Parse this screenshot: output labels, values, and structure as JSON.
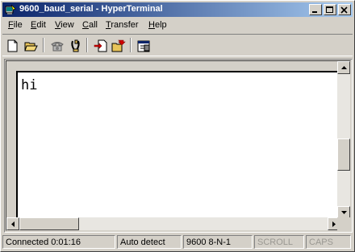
{
  "window": {
    "title": "9600_baud_serial - HyperTerminal",
    "title_bar_colors": {
      "start": "#0a246a",
      "end": "#a6caf0"
    }
  },
  "title_buttons": {
    "minimize": "minimize-icon",
    "maximize": "maximize-icon",
    "close": "close-icon"
  },
  "menu": {
    "items": [
      {
        "label": "File",
        "underline": "F"
      },
      {
        "label": "Edit",
        "underline": "E"
      },
      {
        "label": "View",
        "underline": "V"
      },
      {
        "label": "Call",
        "underline": "C"
      },
      {
        "label": "Transfer",
        "underline": "T"
      },
      {
        "label": "Help",
        "underline": "H"
      }
    ]
  },
  "toolbar": {
    "buttons": [
      "new-document-icon",
      "open-folder-icon",
      "connect-phone-icon",
      "disconnect-phone-icon",
      "send-file-icon",
      "receive-file-icon",
      "properties-icon"
    ]
  },
  "terminal": {
    "text": "hi"
  },
  "statusbar": {
    "connection": "Connected 0:01:16",
    "detect": "Auto detect",
    "settings": "9600 8-N-1",
    "scroll": "SCROLL",
    "caps": "CAPS"
  }
}
